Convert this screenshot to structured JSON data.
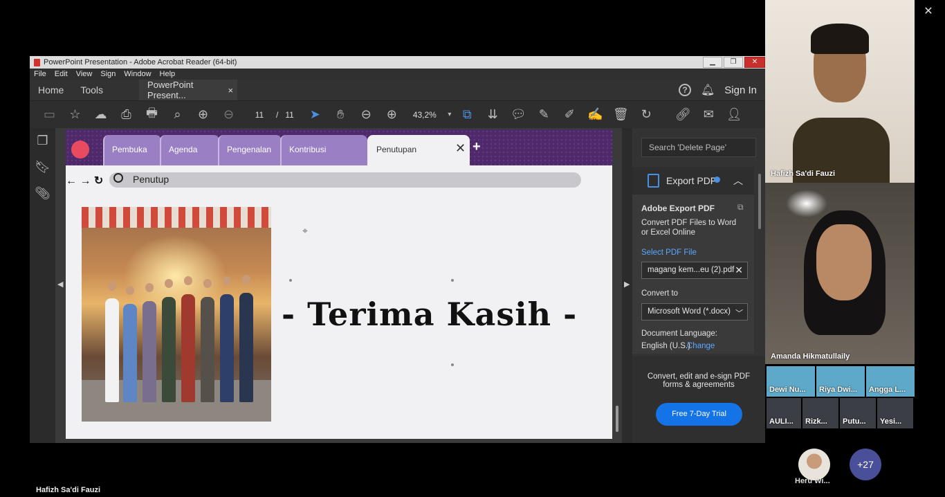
{
  "window": {
    "title": "PowerPoint Presentation - Adobe Acrobat Reader (64-bit)"
  },
  "menu": [
    "File",
    "Edit",
    "View",
    "Sign",
    "Window",
    "Help"
  ],
  "tabs": {
    "home": "Home",
    "tools": "Tools",
    "document": "PowerPoint Present...",
    "close": "×",
    "sign_in": "Sign In"
  },
  "toolbar": {
    "page_current": "11",
    "page_sep": "/",
    "page_total": "11",
    "zoom": "43,2%"
  },
  "slide": {
    "tabs": [
      "Pembuka",
      "Agenda",
      "Pengenalan",
      "Kontribusi",
      "Penutupan"
    ],
    "close_tab": "✕",
    "new_tab": "+",
    "nav_arrows": "← → ↻",
    "address": "Penutup",
    "thanks": "- Terima Kasih -"
  },
  "right_panel": {
    "search_placeholder": "Search 'Delete Page'",
    "export_title": "Export PDF",
    "adobe_export": "Adobe Export PDF",
    "desc_line1": "Convert PDF Files to Word",
    "desc_line2": "or Excel Online",
    "select_label": "Select PDF File",
    "file_name": "magang kem...eu (2).pdf",
    "convert_label": "Convert to",
    "convert_value": "Microsoft Word (*.docx)",
    "doc_lang_label": "Document Language:",
    "doc_lang_value": "English (U.S.)",
    "change_link": "Change",
    "promo_line1": "Convert, edit and e-sign PDF",
    "promo_line2": "forms & agreements",
    "trial_button": "Free 7-Day Trial"
  },
  "meeting": {
    "participant1": "Hafizh Sa'di Fauzi",
    "participant2": "Amanda Hikmatullaily",
    "mini": [
      "Dewi Nu...",
      "Riya Dwi...",
      "Angga L...",
      "AULI...",
      "Rizk...",
      "Putu...",
      "Yesi..."
    ],
    "avatar_name": "Heru Wi...",
    "more_count": "+27",
    "speaker": "Hafizh Sa'di Fauzi"
  }
}
